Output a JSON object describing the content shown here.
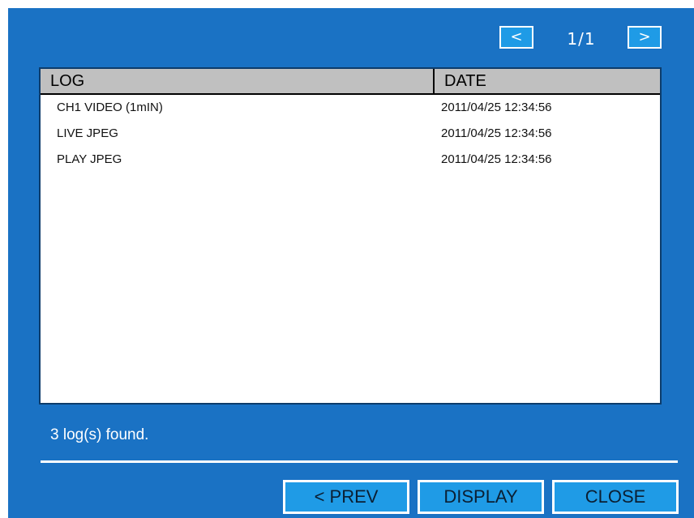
{
  "pagination": {
    "prev_label": "<",
    "page_indicator": "1/1",
    "next_label": ">"
  },
  "table": {
    "headers": {
      "log": "LOG",
      "date": "DATE"
    },
    "rows": [
      {
        "log": "CH1   VIDEO (1mIN)",
        "date": "2011/04/25  12:34:56"
      },
      {
        "log": "LIVE JPEG",
        "date": "2011/04/25  12:34:56"
      },
      {
        "log": "PLAY JPEG",
        "date": "2011/04/25  12:34:56"
      }
    ]
  },
  "status": {
    "text": "3 log(s) found."
  },
  "buttons": {
    "prev": "< PREV",
    "display": "DISPLAY",
    "close": "CLOSE"
  },
  "colors": {
    "panel_bg": "#1a72c4",
    "button_bg": "#1f9be6",
    "header_bg": "#c0c0c0"
  }
}
